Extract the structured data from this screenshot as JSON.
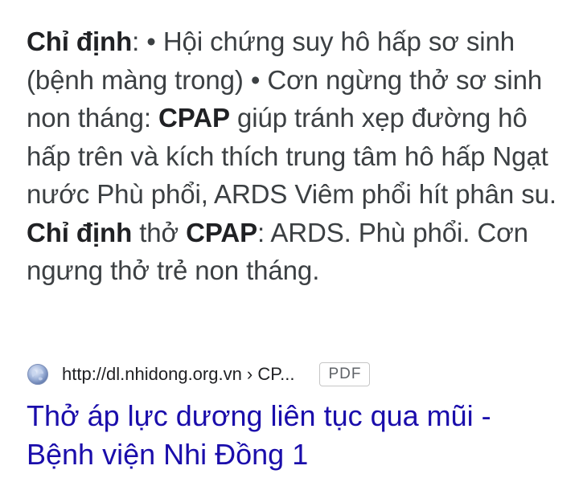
{
  "snippet": {
    "p1": "Chỉ định",
    "p2": ": • Hội chứng suy hô hấp sơ sinh (bệnh màng trong) • Cơn ngừng thở sơ sinh non tháng: ",
    "p3": "CPAP",
    "p4": " giúp tránh xẹp đường hô hấp trên và kích thích trung tâm hô hấp Ngạt nước Phù phổi, ARDS Viêm phổi hít phân su. ",
    "p5": "Chỉ định",
    "p6": " thở ",
    "p7": "CPAP",
    "p8": ": ARDS. Phù phổi. Cơn ngưng thở trẻ non tháng."
  },
  "source": {
    "icon": "globe-icon",
    "url": "http://dl.nhidong.org.vn › CP...",
    "badge": "PDF"
  },
  "result": {
    "title": "Thở áp lực dương liên tục qua mũi - Bệnh viện Nhi Đồng 1"
  },
  "colors": {
    "link": "#1a0dab",
    "text": "#3c4043",
    "badge_border": "#c6c6c6"
  }
}
